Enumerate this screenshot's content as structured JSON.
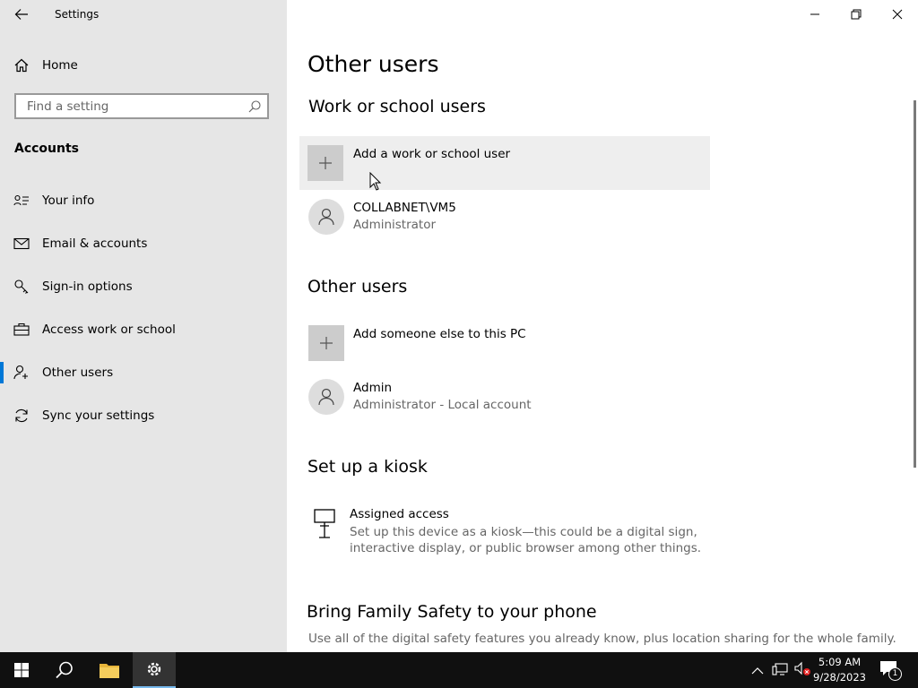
{
  "window": {
    "app_title": "Settings",
    "back_icon": "back-arrow-icon",
    "minimize_icon": "minimize-icon",
    "maximize_icon": "restore-icon",
    "close_icon": "close-icon"
  },
  "sidebar": {
    "home_label": "Home",
    "search_placeholder": "Find a setting",
    "section_title": "Accounts",
    "items": [
      {
        "label": "Your info",
        "icon": "contact-card-icon"
      },
      {
        "label": "Email & accounts",
        "icon": "mail-icon"
      },
      {
        "label": "Sign-in options",
        "icon": "key-icon"
      },
      {
        "label": "Access work or school",
        "icon": "briefcase-icon"
      },
      {
        "label": "Other users",
        "icon": "person-add-icon",
        "selected": true
      },
      {
        "label": "Sync your settings",
        "icon": "sync-icon"
      }
    ]
  },
  "main": {
    "page_title": "Other users",
    "work_section": {
      "title": "Work or school users",
      "add_label": "Add a work or school user",
      "user_name": "COLLABNET\\VM5",
      "user_role": "Administrator"
    },
    "other_section": {
      "title": "Other users",
      "add_label": "Add someone else to this PC",
      "user_name": "Admin",
      "user_role": "Administrator - Local account"
    },
    "kiosk_section": {
      "title": "Set up a kiosk",
      "item_title": "Assigned access",
      "item_desc_line1": "Set up this device as a kiosk—this could be a digital sign,",
      "item_desc_line2": "interactive display, or public browser among other things."
    },
    "family_section": {
      "title": "Bring Family Safety to your phone",
      "desc": "Use all of the digital safety features you already know, plus location sharing for the whole family."
    }
  },
  "taskbar": {
    "time": "5:09 AM",
    "date": "9/28/2023",
    "notification_count": "1"
  },
  "colors": {
    "accent": "#0078d7",
    "sidebar_bg": "#e6e6e6",
    "taskbar_bg": "#101010",
    "selected_row_bg": "#eeeeee"
  }
}
